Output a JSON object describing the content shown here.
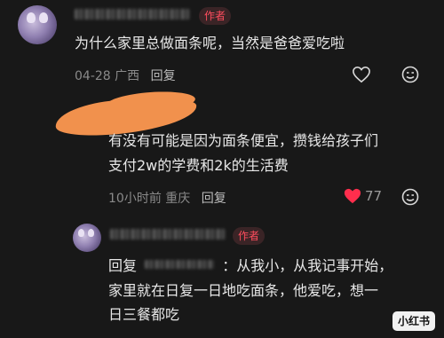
{
  "comments": [
    {
      "author_tag": "作者",
      "text": "为什么家里总做面条呢，当然是爸爸爱吃啦",
      "date": "04-28",
      "location": "广西",
      "reply_label": "回复"
    },
    {
      "text_lines": [
        "有没有可能是因为面条便宜，攒钱给孩子们",
        "支付2w的学费和2k的生活费"
      ],
      "time": "10小时前",
      "location": "重庆",
      "reply_label": "回复",
      "likes": "77"
    },
    {
      "author_tag": "作者",
      "reply_prefix": "回复",
      "text_line1": "：从我小，从我记事开始，",
      "text_lines": [
        "家里就在日复一日地吃面条，他爱吃，想一",
        "日三餐都吃"
      ]
    }
  ],
  "watermark": "小红书",
  "colors": {
    "accent": "#ff4d5e",
    "background": "#181818"
  }
}
